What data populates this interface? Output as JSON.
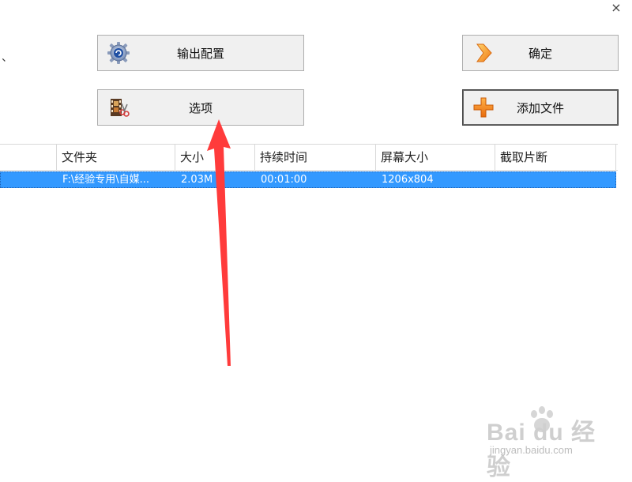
{
  "window": {
    "close_glyph": "×",
    "stray_mark": "、"
  },
  "buttons": {
    "output_config": {
      "label": "输出配置",
      "icon": "gear-icon"
    },
    "options": {
      "label": "选项",
      "icon": "film-scissors-icon"
    },
    "confirm": {
      "label": "确定",
      "icon": "arrow-right-icon"
    },
    "add_file": {
      "label": "添加文件",
      "icon": "plus-icon"
    }
  },
  "table": {
    "columns": [
      "文件夹",
      "大小",
      "持续时间",
      "屏幕大小",
      "截取片断"
    ],
    "rows": [
      {
        "folder": "F:\\经验专用\\自媒...",
        "size": "2.03M",
        "duration": "00:01:00",
        "screen_size": "1206x804",
        "clip": ""
      }
    ],
    "selected_row_color": "#3399ff"
  },
  "annotation": {
    "arrow_color": "#ff3b3b"
  },
  "watermark": {
    "brand": "Bai du 经验",
    "url": "jingyan.baidu.com"
  }
}
